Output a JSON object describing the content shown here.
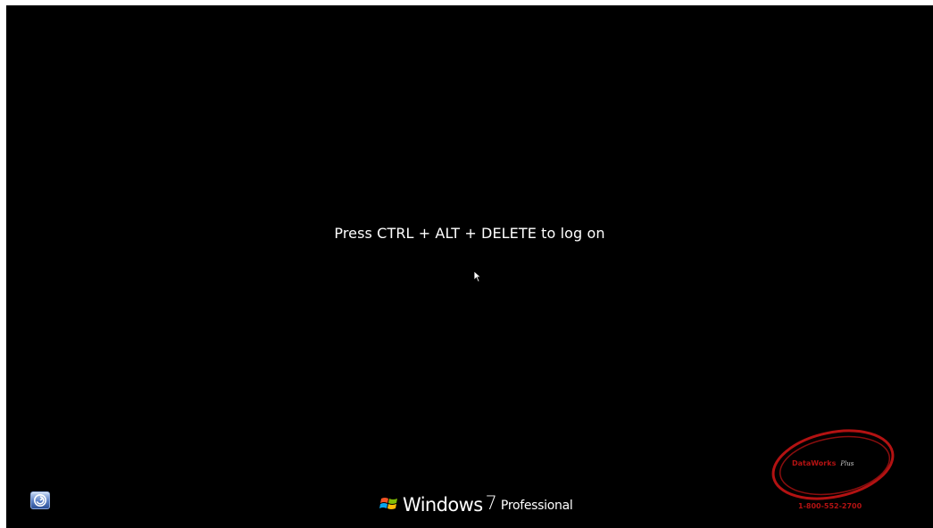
{
  "logon": {
    "prompt": "Press CTRL + ALT + DELETE to log on"
  },
  "ease_of_access": {
    "icon": "ease-of-access-icon"
  },
  "branding": {
    "logo_icon": "windows-flag-icon",
    "name": "Windows",
    "version": "7",
    "edition": "Professional"
  },
  "watermark": {
    "company": "DataWorks",
    "company_suffix": "Plus",
    "phone": "1-800-552-2700",
    "color": "#b31212"
  },
  "colors": {
    "background": "#000000",
    "text": "#ffffff"
  }
}
